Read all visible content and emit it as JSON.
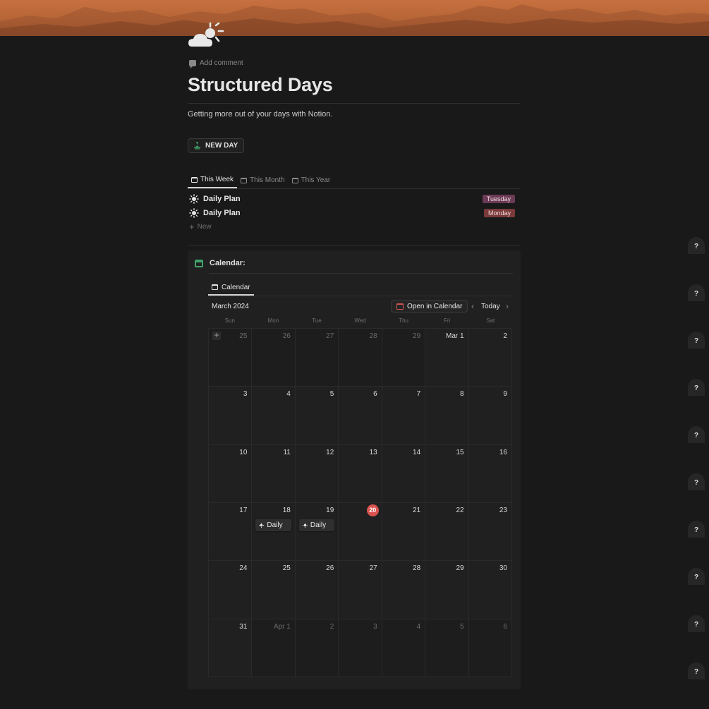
{
  "page": {
    "add_comment": "Add comment",
    "title": "Structured Days",
    "subtitle": "Getting more out of your days with Notion.",
    "new_day_button": "NEW DAY"
  },
  "views": {
    "tabs": [
      {
        "label": "This Week",
        "active": true
      },
      {
        "label": "This Month",
        "active": false
      },
      {
        "label": "This Year",
        "active": false
      }
    ],
    "rows": [
      {
        "name": "Daily Plan",
        "tag": "Tuesday",
        "tag_color": "#6b3a55"
      },
      {
        "name": "Daily Plan",
        "tag": "Monday",
        "tag_color": "#7a3a3a"
      }
    ],
    "new_label": "New"
  },
  "calendar": {
    "heading": "Calendar:",
    "view_tab": "Calendar",
    "month": "March 2024",
    "open_button": "Open in Calendar",
    "today_button": "Today",
    "weekdays": [
      "Sun",
      "Mon",
      "Tue",
      "Wed",
      "Thu",
      "Fri",
      "Sat"
    ],
    "weeks": [
      [
        {
          "d": "25",
          "m": true
        },
        {
          "d": "26",
          "m": true
        },
        {
          "d": "27",
          "m": true
        },
        {
          "d": "28",
          "m": true
        },
        {
          "d": "29",
          "m": true
        },
        {
          "d": "Mar 1",
          "m": false
        },
        {
          "d": "2",
          "m": false
        }
      ],
      [
        {
          "d": "3"
        },
        {
          "d": "4"
        },
        {
          "d": "5"
        },
        {
          "d": "6"
        },
        {
          "d": "7"
        },
        {
          "d": "8"
        },
        {
          "d": "9"
        }
      ],
      [
        {
          "d": "10"
        },
        {
          "d": "11"
        },
        {
          "d": "12"
        },
        {
          "d": "13"
        },
        {
          "d": "14"
        },
        {
          "d": "15"
        },
        {
          "d": "16"
        }
      ],
      [
        {
          "d": "17"
        },
        {
          "d": "18",
          "event": "Daily"
        },
        {
          "d": "19",
          "event": "Daily"
        },
        {
          "d": "20",
          "today": true
        },
        {
          "d": "21"
        },
        {
          "d": "22"
        },
        {
          "d": "23"
        }
      ],
      [
        {
          "d": "24"
        },
        {
          "d": "25"
        },
        {
          "d": "26"
        },
        {
          "d": "27"
        },
        {
          "d": "28"
        },
        {
          "d": "29"
        },
        {
          "d": "30"
        }
      ],
      [
        {
          "d": "31"
        },
        {
          "d": "Apr 1",
          "m": true
        },
        {
          "d": "2",
          "m": true
        },
        {
          "d": "3",
          "m": true
        },
        {
          "d": "4",
          "m": true
        },
        {
          "d": "5",
          "m": true
        },
        {
          "d": "6",
          "m": true
        }
      ]
    ],
    "today_color": "#d9534f"
  },
  "help_button": {
    "label": "?",
    "count": 10
  },
  "colors": {
    "background": "#191919",
    "accent_green": "#3fa26a",
    "cover": "#c8703f"
  }
}
